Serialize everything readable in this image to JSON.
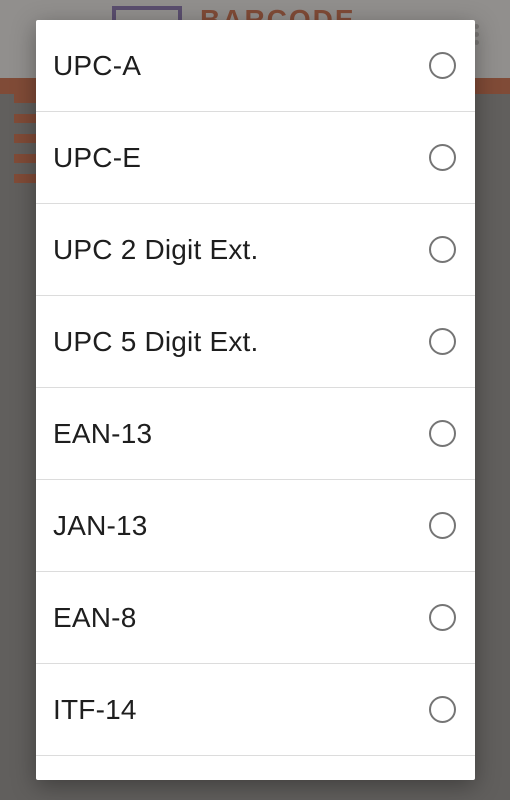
{
  "background": {
    "logo_text": "BARCODE",
    "accent_color": "#a55537"
  },
  "dialog": {
    "options": [
      {
        "label": "UPC-A",
        "selected": false
      },
      {
        "label": "UPC-E",
        "selected": false
      },
      {
        "label": "UPC 2 Digit Ext.",
        "selected": false
      },
      {
        "label": "UPC 5 Digit Ext.",
        "selected": false
      },
      {
        "label": "EAN-13",
        "selected": false
      },
      {
        "label": "JAN-13",
        "selected": false
      },
      {
        "label": "EAN-8",
        "selected": false
      },
      {
        "label": "ITF-14",
        "selected": false
      }
    ]
  },
  "icons": {
    "radio": "radio-unchecked-icon",
    "overflow": "more-vertical-icon",
    "logo": "barcode-logo-icon"
  }
}
